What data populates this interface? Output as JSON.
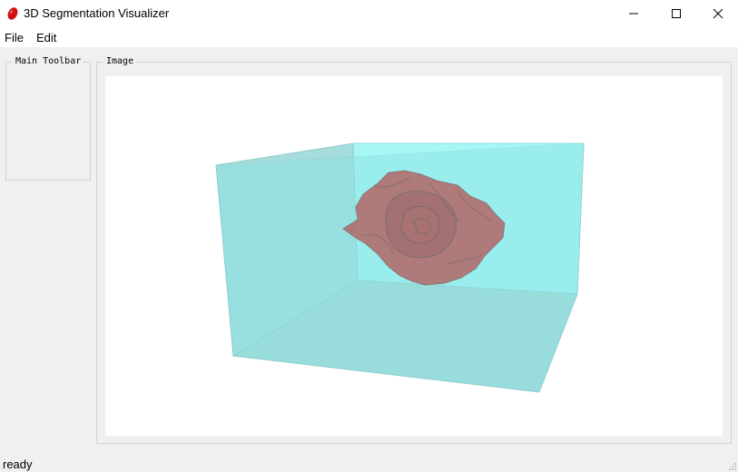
{
  "window": {
    "title": "3D Segmentation Visualizer",
    "icon": "red-blob-icon",
    "controls": [
      "minimize-icon",
      "maximize-icon",
      "close-icon"
    ]
  },
  "menu": {
    "file_label": "File",
    "edit_label": "Edit"
  },
  "groups": {
    "toolbar_title": "Main Toolbar",
    "image_title": "Image"
  },
  "viewport": {
    "content": "3D render",
    "box_color": "#9ef3f3",
    "segment_color": "#d11a1a"
  },
  "status": {
    "text": "ready"
  }
}
